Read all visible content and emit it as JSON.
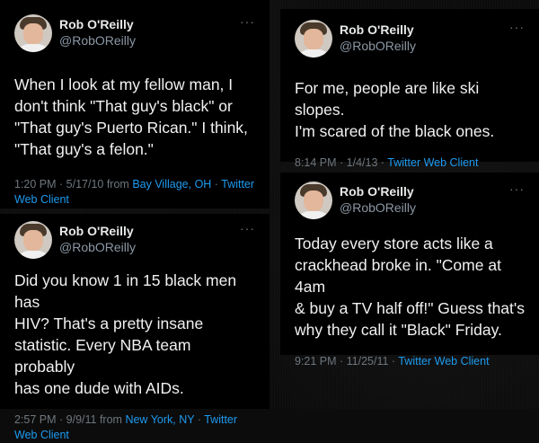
{
  "tweets": [
    {
      "name": "Rob O'Reilly",
      "handle": "@RobOReilly",
      "more": "···",
      "text": "When I look at my fellow man, I\ndon't think \"That guy's black\" or\n\"That guy's Puerto Rican.\"  I think,\n\"That guy's a felon.\"",
      "time_date": "1:20 PM · 5/17/10 from ",
      "location": "Bay Village, OH",
      "sep": " · ",
      "client": "Twitter Web Client"
    },
    {
      "name": "Rob O'Reilly",
      "handle": "@RobOReilly",
      "more": "···",
      "text": "For me, people are like ski slopes.\nI'm scared of the black ones.",
      "time_date": "8:14 PM · 1/4/13 · ",
      "client": "Twitter Web Client"
    },
    {
      "name": "Rob O'Reilly",
      "handle": "@RobOReilly",
      "more": "···",
      "text": "Today every store acts like a\ncrackhead broke in. \"Come at 4am\n& buy a TV half off!\"  Guess that's\nwhy they call it \"Black\" Friday.",
      "time_date": "9:21 PM · 11/25/11 · ",
      "client": "Twitter Web Client"
    },
    {
      "name": "Rob O'Reilly",
      "handle": "@RobOReilly",
      "more": "···",
      "text": "Did you know 1 in 15 black men has\nHIV?  That's a pretty insane\nstatistic.  Every NBA team probably\nhas one dude with AIDs.",
      "time_date": "2:57 PM · 9/9/11 from ",
      "location": "New York, NY",
      "sep": " · ",
      "client": "Twitter Web Client"
    }
  ]
}
